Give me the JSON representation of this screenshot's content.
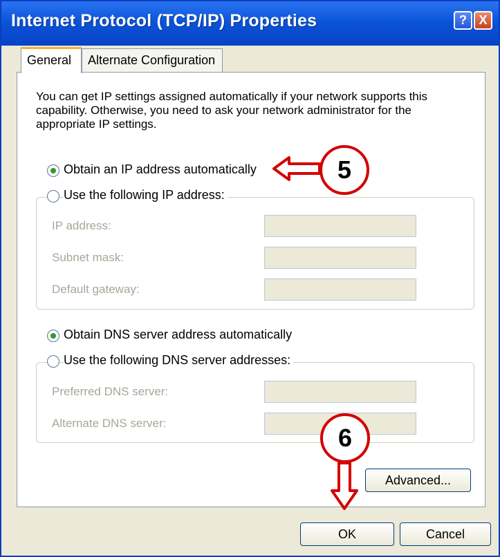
{
  "window": {
    "title": "Internet Protocol (TCP/IP) Properties",
    "help_button": "?",
    "close_button": "X"
  },
  "tabs": [
    {
      "label": "General",
      "active": true
    },
    {
      "label": "Alternate Configuration",
      "active": false
    }
  ],
  "description": "You can get IP settings assigned automatically if your network supports this capability. Otherwise, you need to ask your network administrator for the appropriate IP settings.",
  "ip_options": {
    "auto_label": "Obtain an IP address automatically",
    "manual_label": "Use the following IP address:",
    "selected": "auto",
    "fields": [
      {
        "label": "IP address:",
        "value": ""
      },
      {
        "label": "Subnet mask:",
        "value": ""
      },
      {
        "label": "Default gateway:",
        "value": ""
      }
    ]
  },
  "dns_options": {
    "auto_label": "Obtain DNS server address automatically",
    "manual_label": "Use the following DNS server addresses:",
    "selected": "auto",
    "fields": [
      {
        "label": "Preferred DNS server:",
        "value": ""
      },
      {
        "label": "Alternate DNS server:",
        "value": ""
      }
    ]
  },
  "buttons": {
    "advanced": "Advanced...",
    "ok": "OK",
    "cancel": "Cancel"
  },
  "annotations": {
    "step5": "5",
    "step6": "6",
    "color": "#d40000"
  }
}
